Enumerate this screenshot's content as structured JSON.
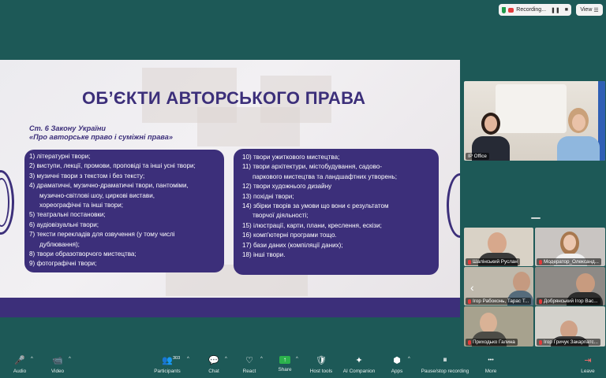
{
  "topbar": {
    "recording_label": "Recording...",
    "pause_glyph": "❚❚",
    "stop_glyph": "■",
    "view_label": "View",
    "view_glyph": "☰"
  },
  "slide": {
    "title": "ОБ’ЄКТИ АВТОРСЬКОГО ПРАВА",
    "subtitle_line1": "Ст. 6 Закону України",
    "subtitle_line2": "«Про авторське право і суміжні права»",
    "left_items": [
      "1) літературні твори;",
      "2) виступи, лекції, промови, проповіді та інші усні твори;",
      "3) музичні твори з текстом і без тексту;",
      "4) драматичні, музично-драматичні твори, пантоміми,",
      "музично-світлові шоу, циркові вистави,",
      "хореографічні та інші твори;",
      "5) театральні постановки;",
      "6) аудіовізуальні твори;",
      "7) тексти перекладів для озвучення (у тому числі",
      "дублювання);",
      "8) твори образотворчого мистецтва;",
      "9) фотографічні твори;"
    ],
    "right_items": [
      "10) твори ужиткового мистецтва;",
      "11) твори архітектури, містобудування, садово-",
      "паркового мистецтва та ландшафтних утворень;",
      "12) твори художнього дизайну",
      "13) похідні твори;",
      "14) збірки творів за умови що вони є результатом",
      "творчої діяльності;",
      "15) ілюстрації, карти, плани, креслення, ескізи;",
      "16) комп'ютерні програми тощо.",
      "17) бази даних (компіляції даних);",
      "18) інші твори."
    ]
  },
  "participants": {
    "main_label": "IP Office",
    "tiles": [
      {
        "name": "Шалінський Руслан"
      },
      {
        "name": "Модератор_Олександ..."
      },
      {
        "name": "Ігор Рабоконь, Тарас Т..."
      },
      {
        "name": "Добрянський Ігор Вас..."
      },
      {
        "name": "Приходько Галина"
      },
      {
        "name": "Ігор Гричук Закарпатс..."
      }
    ]
  },
  "toolbar": {
    "count": "303",
    "items": [
      {
        "label": "Audio",
        "icon": "🎤"
      },
      {
        "label": "Video",
        "icon": "📹"
      },
      {
        "label": "Participants",
        "icon": "👥"
      },
      {
        "label": "Chat",
        "icon": "💬"
      },
      {
        "label": "React",
        "icon": "♡"
      },
      {
        "label": "Share",
        "icon": "↑"
      },
      {
        "label": "Host tools",
        "icon": "🛡"
      },
      {
        "label": "AI Companion",
        "icon": "✦"
      },
      {
        "label": "Apps",
        "icon": "⬢"
      },
      {
        "label": "Pause/stop recording",
        "icon": "⏸"
      },
      {
        "label": "More",
        "icon": "•••"
      },
      {
        "label": "Leave",
        "icon": "⇥"
      }
    ]
  }
}
